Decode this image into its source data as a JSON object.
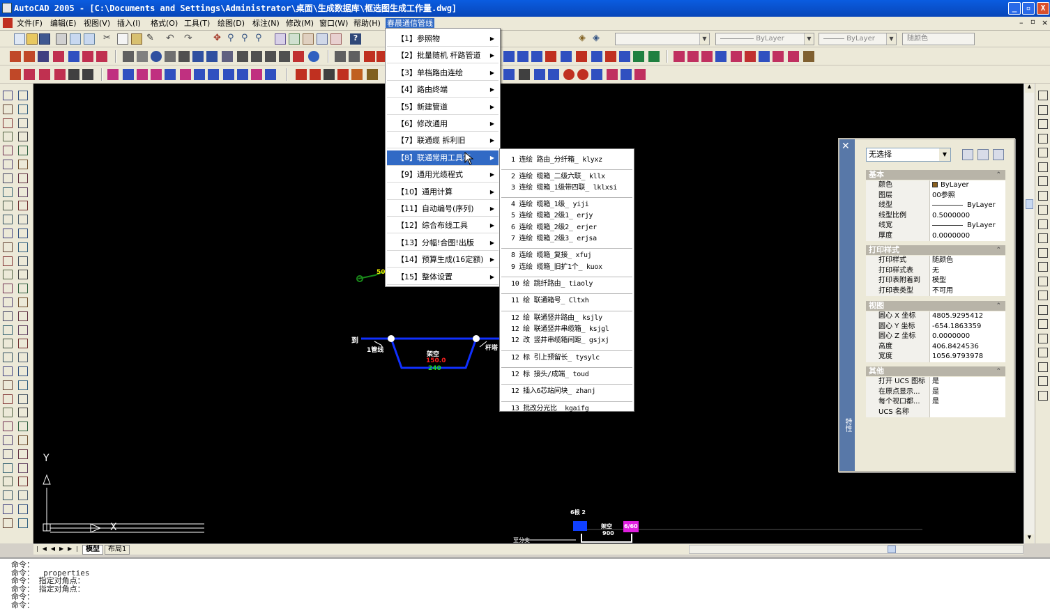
{
  "window": {
    "title": "AutoCAD 2005 - [C:\\Documents and Settings\\Administrator\\桌面\\生成数据库\\框选图生成工作量.dwg]",
    "minimize": "_",
    "restore": "▫",
    "close": "X"
  },
  "menubar": {
    "items": [
      "文件(F)",
      "编辑(E)",
      "视图(V)",
      "插入(I)",
      "格式(O)",
      "工具(T)",
      "绘图(D)",
      "标注(N)",
      "修改(M)",
      "窗口(W)",
      "帮助(H)",
      "春晨通信管线"
    ]
  },
  "layer_combos": {
    "linetype": "ByLayer",
    "lineweight": "ByLayer",
    "color": "随颜色"
  },
  "main_menu": {
    "items": [
      "【1】参照物",
      "【2】批量随机 杆路管道",
      "【3】单档路由连绘",
      "【4】路由终端",
      "【5】新建管道",
      "【6】修改通用",
      "【7】联通缆  拆利旧",
      "【8】联通常用工具箱",
      "【9】通用光缆程式",
      "【10】通用计算",
      "【11】自动编号(序列)",
      "【12】综合布线工具",
      "【13】分幅!合图!出版",
      "【14】预算生成(16定额)",
      "【15】整体设置"
    ],
    "highlighted_index": 7
  },
  "submenu": {
    "items": [
      "1 连绘 路由_分纤箱_ klyxz",
      "2 连绘 缆箱_二级六联_ kllx",
      "3 连绘 缆箱_1级带四联_ lklxsi",
      "4 连绘 缆箱_1级_ yiji",
      "5 连绘 缆箱_2级1_ erjy",
      "6 连绘 缆箱_2级2_ erjer",
      "7 连绘 缆箱_2级3_ erjsa",
      "8 连绘 缆箱_复接_ xfuj",
      "9 连绘 缆箱_旧扩1个_ kuox",
      "10 绘 跳纤路由_ tiaoly",
      "11 绘 联通箱号_ Cltxh",
      "12 绘 联通竖井路由_ ksjly",
      "12 绘 联通竖井串缆箱_ ksjgl",
      "12 改 竖井串缆箱间距_ gsjxj",
      "12 标 引上预留长_ tysylc",
      "12 标 接头/成端_ toud",
      "12 插入6芯站间块_ zhanj",
      "13 批改分光比_ kgaifg"
    ]
  },
  "properties": {
    "selection": "无选择",
    "sections": [
      {
        "title": "基本",
        "rows": [
          {
            "k": "颜色",
            "v": "ByLayer"
          },
          {
            "k": "图层",
            "v": "00参照"
          },
          {
            "k": "线型",
            "v": "ByLayer"
          },
          {
            "k": "线型比例",
            "v": "0.5000000"
          },
          {
            "k": "线宽",
            "v": "ByLayer"
          },
          {
            "k": "厚度",
            "v": "0.0000000"
          }
        ]
      },
      {
        "title": "打印样式",
        "rows": [
          {
            "k": "打印样式",
            "v": "随颜色"
          },
          {
            "k": "打印样式表",
            "v": "无"
          },
          {
            "k": "打印表附着到",
            "v": "模型"
          },
          {
            "k": "打印表类型",
            "v": "不可用"
          }
        ]
      },
      {
        "title": "视图",
        "rows": [
          {
            "k": "圆心 X 坐标",
            "v": "4805.9295412"
          },
          {
            "k": "圆心 Y 坐标",
            "v": "-654.1863359"
          },
          {
            "k": "圆心 Z 坐标",
            "v": "0.0000000"
          },
          {
            "k": "高度",
            "v": "406.8424536"
          },
          {
            "k": "宽度",
            "v": "1056.9793978"
          }
        ]
      },
      {
        "title": "其他",
        "rows": [
          {
            "k": "打开 UCS 图标",
            "v": "是"
          },
          {
            "k": "在原点显示...",
            "v": "是"
          },
          {
            "k": "每个视口都...",
            "v": "是"
          },
          {
            "k": "UCS 名称",
            "v": ""
          }
        ]
      }
    ],
    "strip_label": "特性"
  },
  "drawing": {
    "left_label": "架空",
    "left_value": "150.0",
    "left_sub": "240",
    "side_a": "到",
    "side_b": "1管线",
    "side_c": "杆塔",
    "green_label": "50",
    "bottom_a": "6根 2",
    "bottom_b": "架空",
    "bottom_c": "900",
    "bottom_d": "6/60",
    "bottom_e": "至分支",
    "axis_y": "Y",
    "axis_x": "X"
  },
  "tabs": [
    "模型",
    "布局1"
  ],
  "command_lines": [
    "命令：",
    "命令： _properties",
    "命令： 指定对角点：",
    "命令： 指定对角点：",
    "命令：",
    "命令："
  ]
}
